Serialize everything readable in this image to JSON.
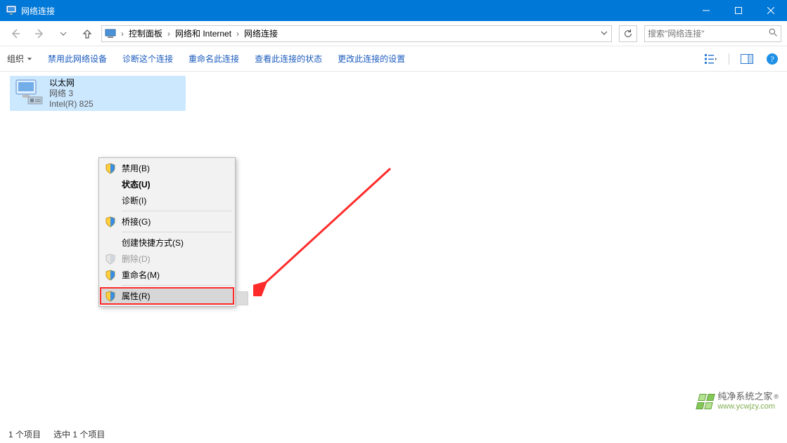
{
  "window": {
    "title": "网络连接"
  },
  "breadcrumb": {
    "items": [
      "控制面板",
      "网络和 Internet",
      "网络连接"
    ]
  },
  "search": {
    "placeholder": "搜索\"网络连接\""
  },
  "toolbar": {
    "organize": "组织",
    "disable": "禁用此网络设备",
    "diagnose": "诊断这个连接",
    "rename": "重命名此连接",
    "view_status": "查看此连接的状态",
    "change_settings": "更改此连接的设置"
  },
  "item": {
    "name": "以太网",
    "network": "网络 3",
    "adapter": "Intel(R) 825"
  },
  "context_menu": {
    "disable": "禁用(B)",
    "status": "状态(U)",
    "diagnose": "诊断(I)",
    "bridge": "桥接(G)",
    "create_shortcut": "创建快捷方式(S)",
    "delete": "删除(D)",
    "rename": "重命名(M)",
    "properties": "属性(R)"
  },
  "status_bar": {
    "count": "1 个项目",
    "selected": "选中 1 个项目"
  },
  "watermark": {
    "line1": "纯净系统之家",
    "line2": "www.ycwjzy.com",
    "reg": "®"
  }
}
